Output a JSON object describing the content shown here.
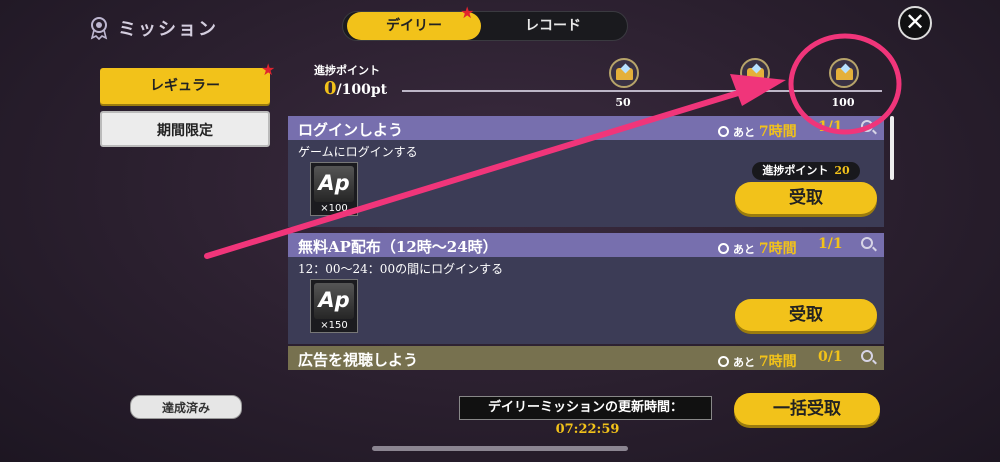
{
  "header": {
    "title": "ミッション",
    "tabs": [
      {
        "label": "デイリー",
        "active": true
      },
      {
        "label": "レコード",
        "active": false
      }
    ],
    "close_icon": "close-icon"
  },
  "sidebar": {
    "regular_label": "レギュラー",
    "limited_label": "期間限定",
    "completed_label": "達成済み"
  },
  "progress": {
    "label": "進捗ポイント",
    "current": "0",
    "max_text": "/100",
    "unit": "pt",
    "fill_fraction": 0,
    "milestones": [
      {
        "value": "50",
        "icon": "treasure-chest-icon"
      },
      {
        "value": "100",
        "icon": "treasure-chest-icon"
      }
    ]
  },
  "missions": [
    {
      "title": "ログインしよう",
      "timer_prefix": "あと",
      "time_left": "7時間",
      "count": "1/1",
      "description": "ゲームにログインする",
      "reward_icon": "Ap",
      "reward_qty": "×100",
      "points_label": "進捗ポイント",
      "points_value": "20",
      "claim_label": "受取"
    },
    {
      "title": "無料AP配布（12時〜24時）",
      "timer_prefix": "あと",
      "time_left": "7時間",
      "count": "1/1",
      "description": "12：00〜24：00の間にログインする",
      "reward_icon": "Ap",
      "reward_qty": "×150",
      "claim_label": "受取"
    },
    {
      "title": "広告を視聴しよう",
      "timer_prefix": "あと",
      "time_left": "7時間",
      "count": "0/1"
    }
  ],
  "footer": {
    "refresh_label": "デイリーミッションの更新時間：",
    "refresh_time": "07:22:59",
    "claim_all_label": "一括受取"
  },
  "colors": {
    "accent_yellow": "#f2c21a",
    "mission_header": "#776fae",
    "ad_header": "#77714f",
    "annotation_pink": "#f0357a"
  }
}
